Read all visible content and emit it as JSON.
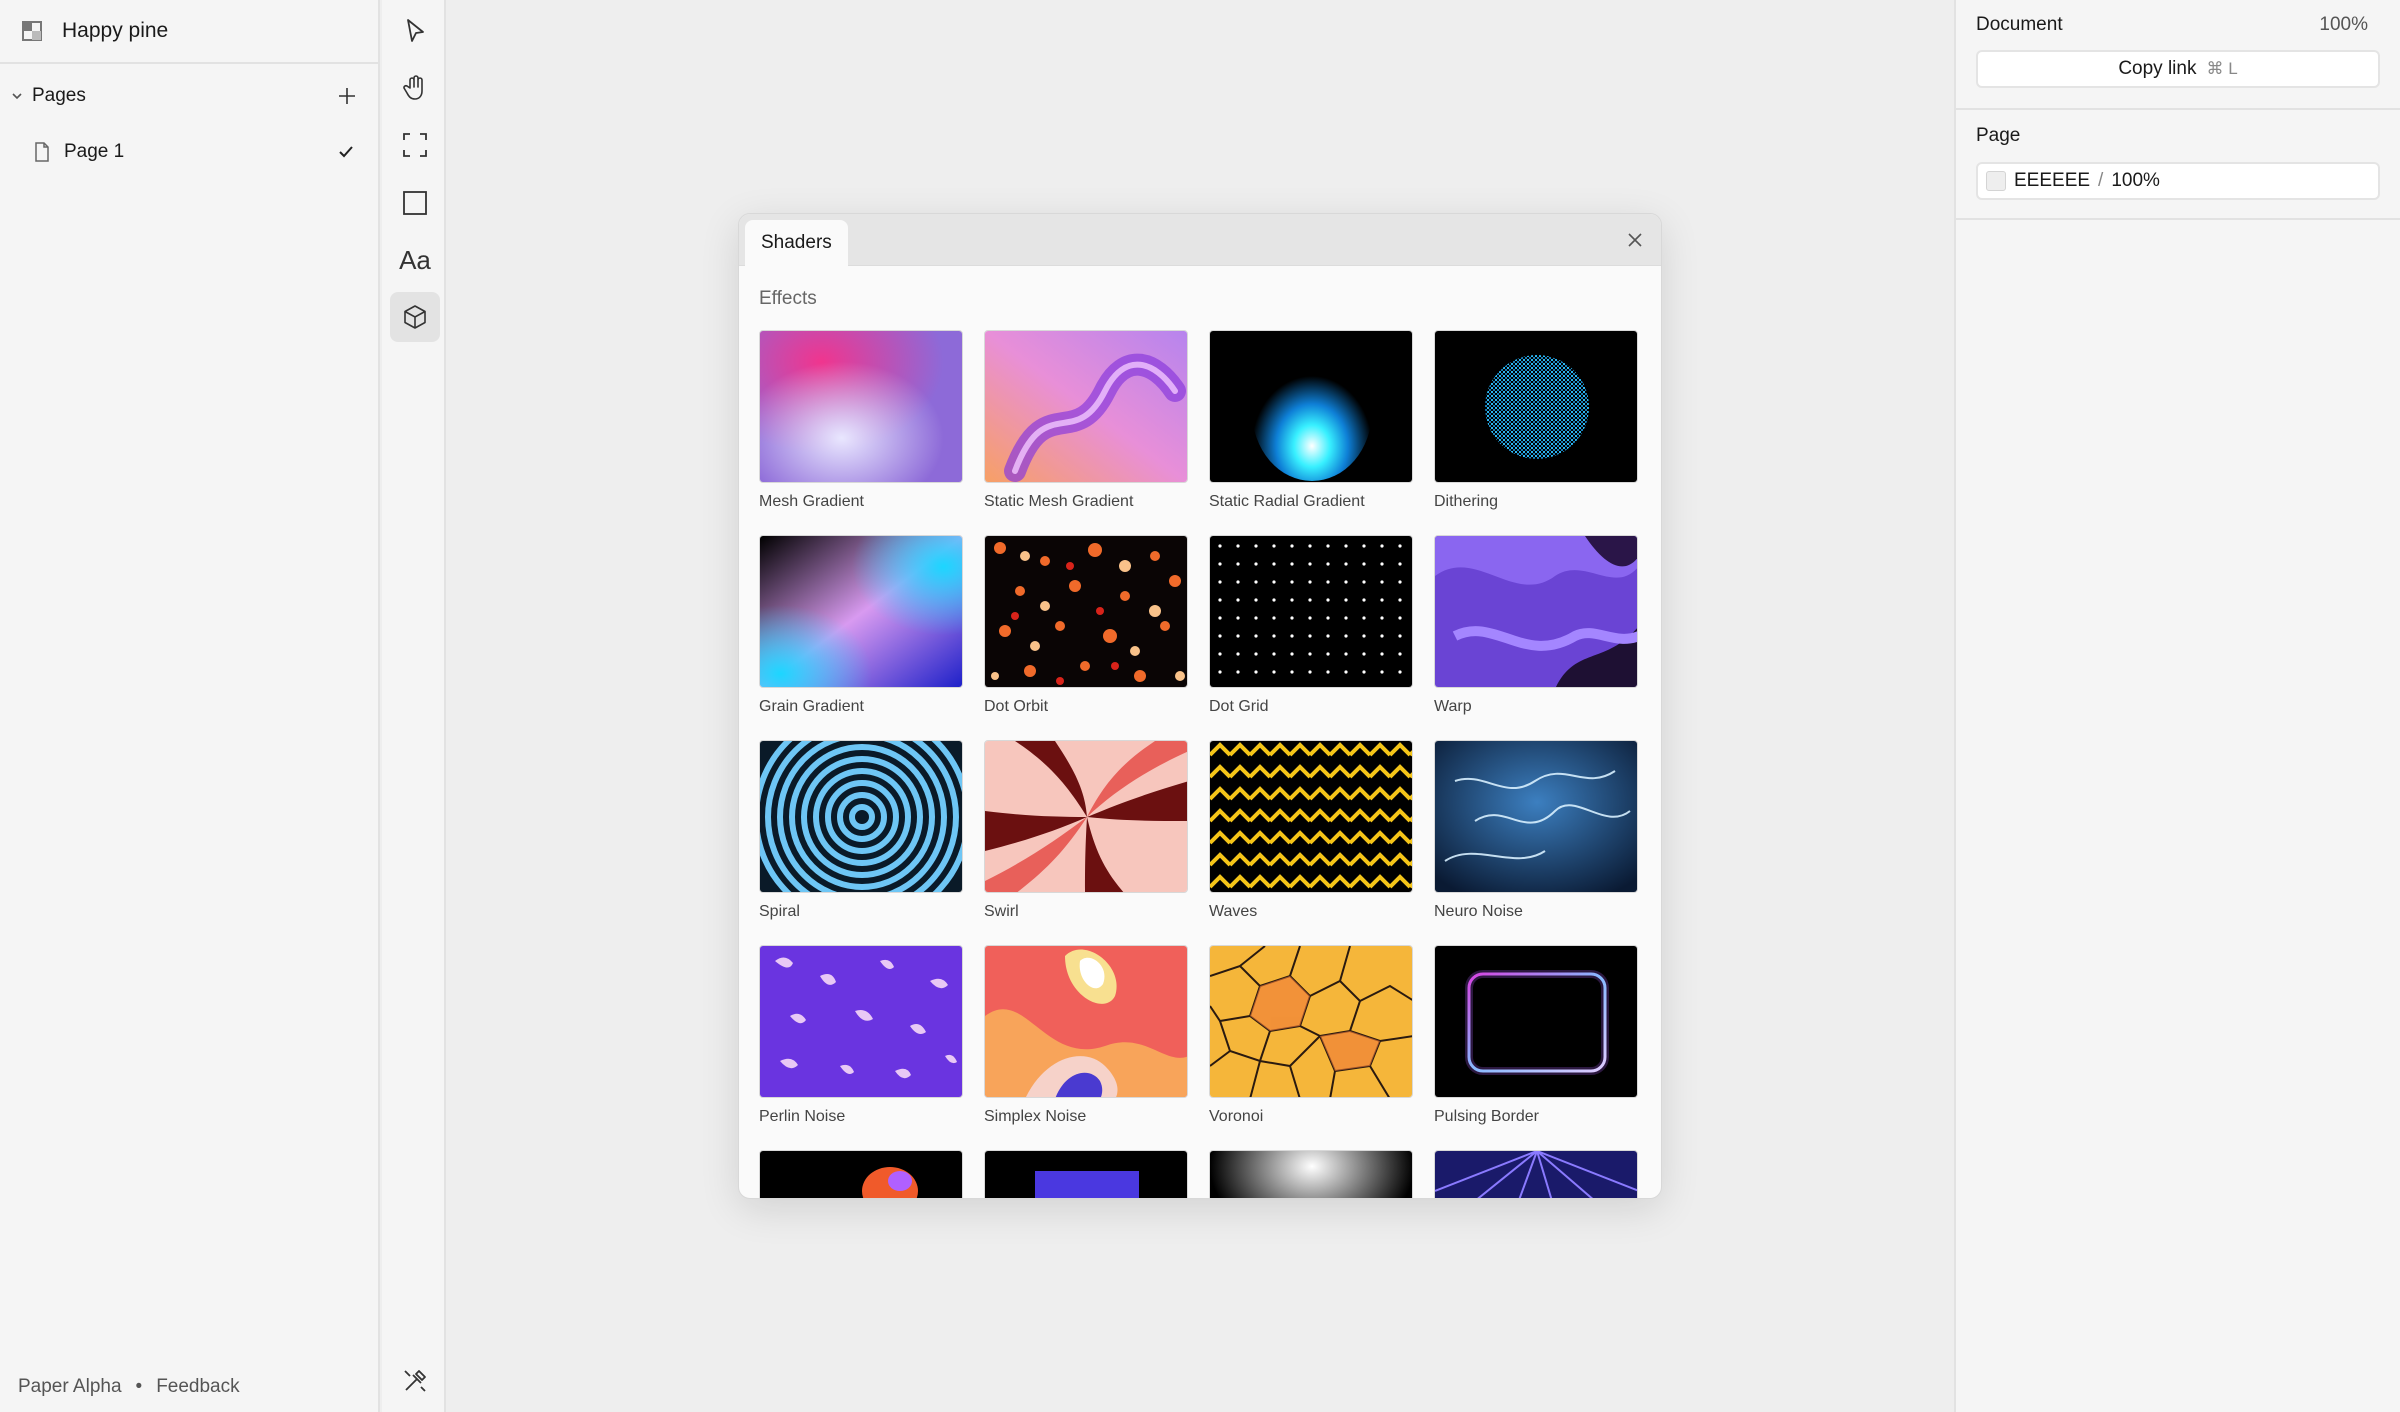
{
  "project": {
    "title": "Happy pine"
  },
  "pages": {
    "header": "Pages",
    "items": [
      {
        "label": "Page 1",
        "selected": true
      }
    ]
  },
  "footer": {
    "app_name": "Paper Alpha",
    "separator": "•",
    "feedback": "Feedback"
  },
  "toolbar": {
    "tools": [
      {
        "icon": "pointer-icon"
      },
      {
        "icon": "hand-icon"
      },
      {
        "icon": "frame-icon"
      },
      {
        "icon": "rectangle-icon"
      },
      {
        "icon": "text-icon",
        "label": "Aa"
      },
      {
        "icon": "shader-cube-icon",
        "active": true
      }
    ],
    "bottom_tool": {
      "icon": "devtools-icon"
    }
  },
  "right_panel": {
    "document_label": "Document",
    "zoom": "100%",
    "copy_link_label": "Copy link",
    "copy_link_shortcut": "⌘ L",
    "page_label": "Page",
    "background_hex": "EEEEEE",
    "background_separator": "/",
    "background_opacity": "100%",
    "background_color": "#eeeeee"
  },
  "dialog": {
    "tab_label": "Shaders",
    "section_label": "Effects",
    "shaders": [
      {
        "label": "Mesh Gradient"
      },
      {
        "label": "Static Mesh Gradient"
      },
      {
        "label": "Static Radial Gradient"
      },
      {
        "label": "Dithering"
      },
      {
        "label": "Grain Gradient"
      },
      {
        "label": "Dot Orbit"
      },
      {
        "label": "Dot Grid"
      },
      {
        "label": "Warp"
      },
      {
        "label": "Spiral"
      },
      {
        "label": "Swirl"
      },
      {
        "label": "Waves"
      },
      {
        "label": "Neuro Noise"
      },
      {
        "label": "Perlin Noise"
      },
      {
        "label": "Simplex Noise"
      },
      {
        "label": "Voronoi"
      },
      {
        "label": "Pulsing Border"
      }
    ]
  }
}
